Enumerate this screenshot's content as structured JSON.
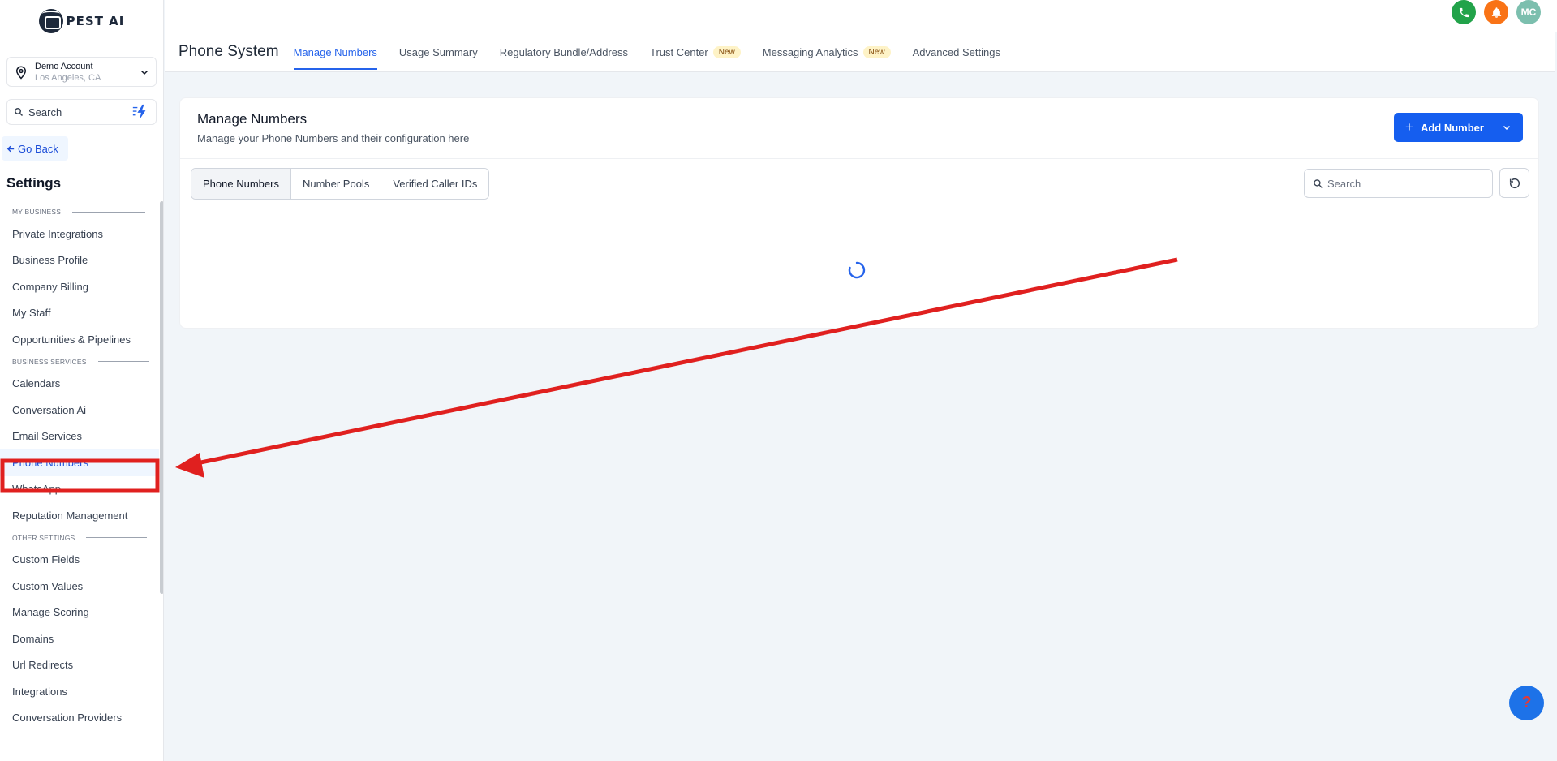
{
  "brand": {
    "logo_text": "PEST AI"
  },
  "account": {
    "name": "Demo Account",
    "location": "Los Angeles, CA"
  },
  "sidebar": {
    "search_placeholder": "Search",
    "go_back": "Go Back",
    "settings_title": "Settings",
    "sections": [
      {
        "label": "MY BUSINESS",
        "items": [
          "Private Integrations",
          "Business Profile",
          "Company Billing",
          "My Staff",
          "Opportunities & Pipelines"
        ]
      },
      {
        "label": "BUSINESS SERVICES",
        "items": [
          "Calendars",
          "Conversation Ai",
          "Email Services",
          "Phone Numbers",
          "WhatsApp",
          "Reputation Management"
        ]
      },
      {
        "label": "OTHER SETTINGS",
        "items": [
          "Custom Fields",
          "Custom Values",
          "Manage Scoring",
          "Domains",
          "Url Redirects",
          "Integrations",
          "Conversation Providers"
        ]
      }
    ],
    "active_item": "Phone Numbers"
  },
  "topbar": {
    "avatar_initials": "MC",
    "colors": {
      "phone": "#22a34a",
      "bell": "#f97316",
      "avatar": "#7cbfae"
    }
  },
  "header": {
    "title": "Phone System",
    "tabs": [
      {
        "label": "Manage Numbers",
        "active": true,
        "badge": ""
      },
      {
        "label": "Usage Summary",
        "active": false,
        "badge": ""
      },
      {
        "label": "Regulatory Bundle/Address",
        "active": false,
        "badge": ""
      },
      {
        "label": "Trust Center",
        "active": false,
        "badge": "New"
      },
      {
        "label": "Messaging Analytics",
        "active": false,
        "badge": "New"
      },
      {
        "label": "Advanced Settings",
        "active": false,
        "badge": ""
      }
    ]
  },
  "card": {
    "title": "Manage Numbers",
    "subtitle": "Manage your Phone Numbers and their configuration here",
    "add_button": "Add Number",
    "segments": [
      "Phone Numbers",
      "Number Pools",
      "Verified Caller IDs"
    ],
    "active_segment": "Phone Numbers",
    "search_placeholder": "Search",
    "loading": true
  },
  "help_label": "?",
  "colors": {
    "accent": "#155eef",
    "annotation": "#e0201f"
  }
}
